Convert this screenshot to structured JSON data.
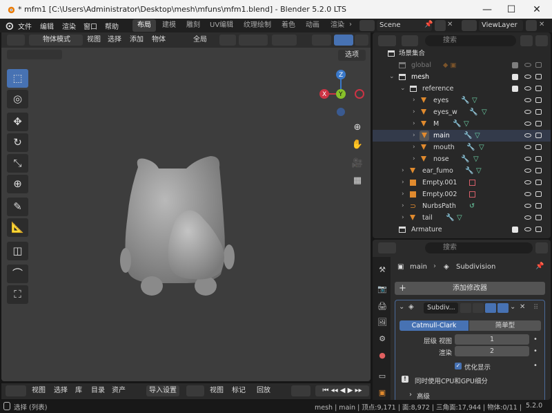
{
  "titlebar": {
    "title": "* mfm1 [C:\\Users\\Administrator\\Desktop\\mesh\\mfuns\\mfm1.blend] - Blender 5.2.0 LTS",
    "min": "—",
    "max": "☐",
    "close": "✕"
  },
  "menu": {
    "items": [
      "文件",
      "编辑",
      "渲染",
      "窗口",
      "帮助"
    ],
    "workspaces": [
      "布局",
      "建模",
      "雕刻",
      "UV编辑",
      "纹理绘制",
      "着色",
      "动画",
      "渲染"
    ],
    "scene": "Scene",
    "viewlayer": "ViewLayer"
  },
  "viewport": {
    "mode": "物体模式",
    "menus": [
      "视图",
      "选择",
      "添加",
      "物体"
    ],
    "orientation": "全局",
    "options": "选项",
    "gizmo": {
      "x": "X",
      "y": "Y",
      "z": "Z"
    }
  },
  "outliner": {
    "search_placeholder": "搜索",
    "root": "场景集合",
    "rows": [
      {
        "name": "global",
        "dim": true
      },
      {
        "name": "mesh"
      },
      {
        "name": "reference"
      },
      {
        "name": "eyes"
      },
      {
        "name": "eyes_w"
      },
      {
        "name": "M"
      },
      {
        "name": "main"
      },
      {
        "name": "mouth"
      },
      {
        "name": "nose"
      },
      {
        "name": "ear_fumo"
      },
      {
        "name": "Empty.001"
      },
      {
        "name": "Empty.002"
      },
      {
        "name": "NurbsPath"
      },
      {
        "name": "tail"
      },
      {
        "name": "Armature"
      }
    ]
  },
  "properties": {
    "search_placeholder": "搜索",
    "breadcrumb_object": "main",
    "breadcrumb_modifier": "Subdivision",
    "add_modifier": "添加修改器",
    "modifier_name": "Subdiv...",
    "mode_a": "Catmull-Clark",
    "mode_b": "简单型",
    "levels_label": "层级 视图",
    "levels_value": "1",
    "render_label": "渲染",
    "render_value": "2",
    "optimize": "优化显示",
    "gpu": "同时使用CPU和GPU细分",
    "advanced": "高级"
  },
  "timeline": {
    "menus": [
      "视图",
      "选择",
      "库",
      "目录",
      "资产"
    ],
    "import": "导入设置",
    "menus2": [
      "视图",
      "标记"
    ],
    "playback": "回放"
  },
  "status": {
    "left": "选择 (列表)",
    "right": "mesh | main | 顶点:9,171 | 面:8,972 | 三角面:17,944 | 物体:0/11 | ",
    "version": "5.2.0"
  }
}
